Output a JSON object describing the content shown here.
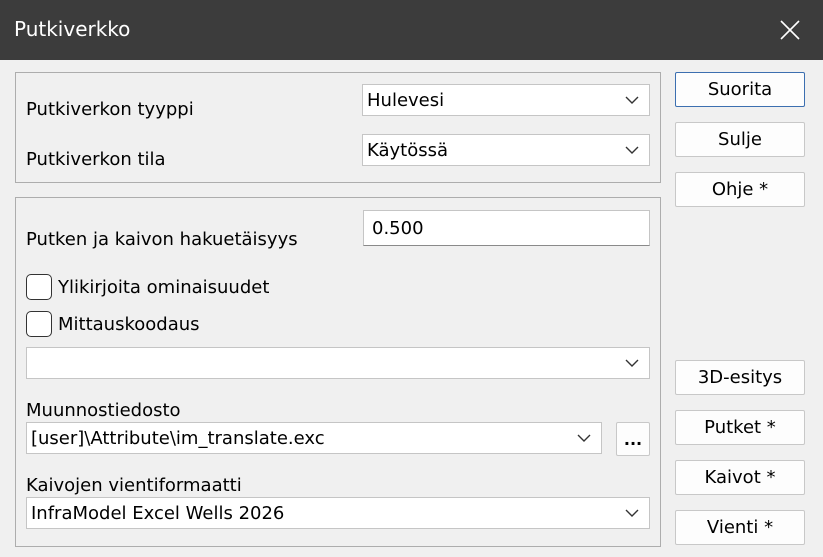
{
  "window": {
    "title": "Putkiverkko"
  },
  "network": {
    "type_label": "Putkiverkon tyyppi",
    "type_value": "Hulevesi",
    "state_label": "Putkiverkon tila",
    "state_value": "Käytössä"
  },
  "options": {
    "distance_label": "Putken ja kaivon hakuetäisyys",
    "distance_value": "0.500",
    "overwrite_label": "Ylikirjoita ominaisuudet",
    "overwrite_checked": false,
    "measure_label": "Mittauskoodaus",
    "measure_checked": false,
    "code_value": "",
    "translation_label": "Muunnostiedosto",
    "translation_value": "[user]\\Attribute\\im_translate.exc",
    "browse_label": "...",
    "export_format_label": "Kaivojen vientiformaatti",
    "export_format_value": "InfraModel Excel Wells 2026"
  },
  "buttons": {
    "run": "Suorita",
    "close": "Sulje",
    "help": "Ohje *",
    "view3d": "3D-esitys",
    "pipes": "Putket *",
    "wells": "Kaivot *",
    "export": "Vienti *"
  },
  "icons": {
    "close": "close-icon",
    "dropdown": "chevron-down-icon"
  }
}
